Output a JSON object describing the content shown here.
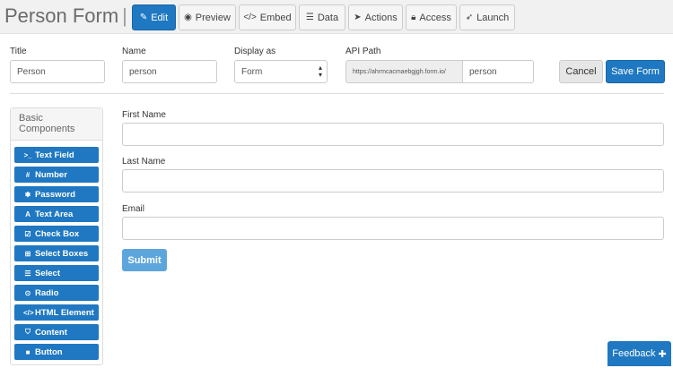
{
  "header": {
    "title": "Person Form",
    "separator": "|",
    "tabs": [
      {
        "label": "Edit",
        "icon": "edit-icon",
        "active": true
      },
      {
        "label": "Preview",
        "icon": "eye-icon",
        "active": false
      },
      {
        "label": "Embed",
        "icon": "code-icon",
        "active": false
      },
      {
        "label": "Data",
        "icon": "database-icon",
        "active": false
      },
      {
        "label": "Actions",
        "icon": "paper-plane-icon",
        "active": false
      },
      {
        "label": "Access",
        "icon": "lock-icon",
        "active": false
      },
      {
        "label": "Launch",
        "icon": "rocket-icon",
        "active": false
      }
    ]
  },
  "settings": {
    "title_label": "Title",
    "title_value": "Person",
    "name_label": "Name",
    "name_value": "person",
    "display_label": "Display as",
    "display_value": "Form",
    "api_label": "API Path",
    "api_prefix": "https://ahrmcacmaebgjgh.form.io/",
    "api_value": "person",
    "cancel_label": "Cancel",
    "save_label": "Save Form"
  },
  "sidebar": {
    "heading": "Basic Components",
    "components": [
      {
        "label": "Text Field",
        "icon": "terminal-icon"
      },
      {
        "label": "Number",
        "icon": "hash-icon"
      },
      {
        "label": "Password",
        "icon": "asterisk-icon"
      },
      {
        "label": "Text Area",
        "icon": "font-icon"
      },
      {
        "label": "Check Box",
        "icon": "checkbox-icon"
      },
      {
        "label": "Select Boxes",
        "icon": "plus-square-icon"
      },
      {
        "label": "Select",
        "icon": "list-icon"
      },
      {
        "label": "Radio",
        "icon": "dot-circle-icon"
      },
      {
        "label": "HTML Element",
        "icon": "code-icon"
      },
      {
        "label": "Content",
        "icon": "html5-icon"
      },
      {
        "label": "Button",
        "icon": "stop-icon"
      }
    ]
  },
  "form": {
    "fields": [
      {
        "label": "First Name",
        "value": ""
      },
      {
        "label": "Last Name",
        "value": ""
      },
      {
        "label": "Email",
        "value": ""
      }
    ],
    "submit_label": "Submit"
  },
  "feedback": {
    "label": "Feedback",
    "icon": "plus-icon"
  },
  "colors": {
    "primary": "#1f78c1",
    "submit": "#5da6dc",
    "header_bg": "#f1f1f1"
  }
}
